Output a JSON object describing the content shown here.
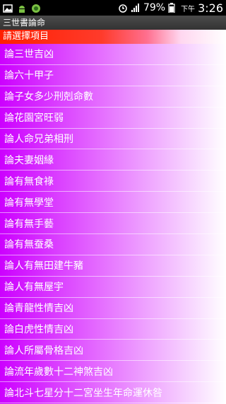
{
  "status_bar": {
    "battery_percent": "79%",
    "time": "3:26",
    "am_pm": "下午",
    "icons": [
      "image-icon",
      "android-icon",
      "app-icon",
      "alarm-icon",
      "signal-icon",
      "battery-icon"
    ]
  },
  "app": {
    "title": "三世書論命"
  },
  "header": {
    "label": "請選擇項目"
  },
  "list": {
    "items": [
      {
        "label": "論三世吉凶"
      },
      {
        "label": "論六十甲子"
      },
      {
        "label": "論子女多少刑剋命數"
      },
      {
        "label": "論花園宮旺弱"
      },
      {
        "label": "論人命兄弟相刑"
      },
      {
        "label": "論夫妻姻緣"
      },
      {
        "label": "論有無食祿"
      },
      {
        "label": "論有無學堂"
      },
      {
        "label": "論有無手藝"
      },
      {
        "label": "論有無蚕桑"
      },
      {
        "label": "論人有無田建牛豬"
      },
      {
        "label": "論人有無屋宇"
      },
      {
        "label": "論青龍性情吉凶"
      },
      {
        "label": "論白虎性情吉凶"
      },
      {
        "label": "論人所屬骨格吉凶"
      },
      {
        "label": "論流年歲數十二神煞吉凶"
      },
      {
        "label": "論北斗七星分十二宮坐生年命運休咎"
      }
    ]
  },
  "colors": {
    "list_gradient_start": "#cc00ff",
    "header_gradient_start": "#ff1f00",
    "title_bar": "#3a3a3a"
  }
}
